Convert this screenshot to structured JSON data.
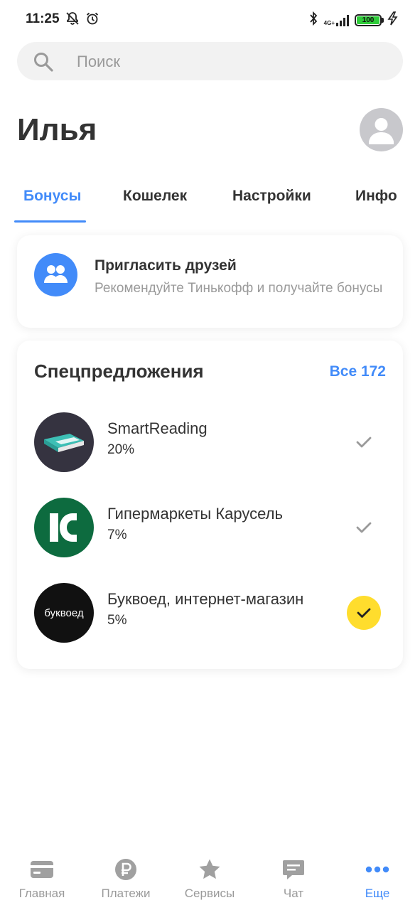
{
  "status_bar": {
    "time": "11:25",
    "network_label": "4G+",
    "battery_level": "100",
    "icons": [
      "notifications-off-icon",
      "alarm-icon",
      "bluetooth-icon",
      "signal-icon",
      "battery-icon",
      "charging-icon"
    ]
  },
  "search": {
    "placeholder": "Поиск"
  },
  "header": {
    "name": "Илья"
  },
  "tabs": [
    {
      "label": "Бонусы",
      "active": true
    },
    {
      "label": "Кошелек",
      "active": false
    },
    {
      "label": "Настройки",
      "active": false
    },
    {
      "label": "Инфо",
      "active": false
    }
  ],
  "invite": {
    "title": "Пригласить друзей",
    "subtitle": "Рекомендуйте Тинькофф и получайте бонусы"
  },
  "offers": {
    "title": "Спецпредложения",
    "all_link": "Все 172",
    "items": [
      {
        "name": "SmartReading",
        "percent": "20%",
        "selected": false
      },
      {
        "name": "Гипермаркеты Карусель",
        "percent": "7%",
        "selected": false
      },
      {
        "name": "Буквоед, интернет-магазин",
        "percent": "5%",
        "selected": true,
        "logo_text": "буквоед"
      }
    ]
  },
  "bottom_nav": [
    {
      "label": "Главная",
      "icon": "card-icon",
      "active": false
    },
    {
      "label": "Платежи",
      "icon": "ruble-icon",
      "active": false
    },
    {
      "label": "Сервисы",
      "icon": "star-icon",
      "active": false
    },
    {
      "label": "Чат",
      "icon": "chat-icon",
      "active": false
    },
    {
      "label": "Еще",
      "icon": "more-dots-icon",
      "active": true
    }
  ],
  "colors": {
    "accent": "#428bf9",
    "selected_check": "#ffdd2d",
    "muted_text": "#9a9a9a",
    "smartreading_bg": "#353340",
    "karusel_bg": "#0d6b3f",
    "bukvoed_bg": "#111111"
  }
}
